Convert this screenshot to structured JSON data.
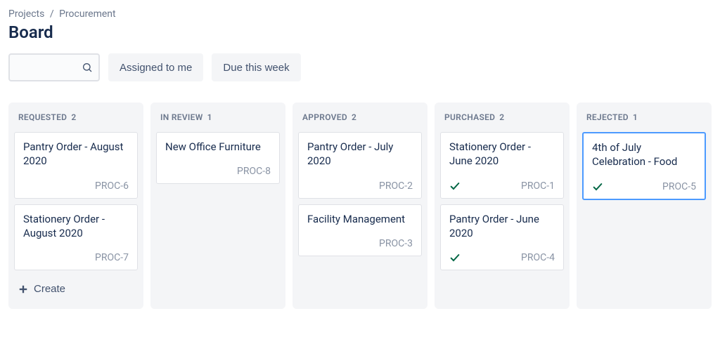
{
  "breadcrumb": {
    "root": "Projects",
    "current": "Procurement"
  },
  "page_title": "Board",
  "search": {
    "placeholder": ""
  },
  "filters": [
    {
      "key": "assigned",
      "label": "Assigned to me"
    },
    {
      "key": "due",
      "label": "Due this week"
    }
  ],
  "create_label": "Create",
  "columns": [
    {
      "key": "requested",
      "title": "REQUESTED",
      "count": 2,
      "show_create": true,
      "cards": [
        {
          "title": "Pantry Order - August 2020",
          "id": "PROC-6",
          "done": false,
          "selected": false
        },
        {
          "title": "Stationery Order - August 2020",
          "id": "PROC-7",
          "done": false,
          "selected": false
        }
      ]
    },
    {
      "key": "in_review",
      "title": "IN REVIEW",
      "count": 1,
      "show_create": false,
      "cards": [
        {
          "title": "New Office Furniture",
          "id": "PROC-8",
          "done": false,
          "selected": false
        }
      ]
    },
    {
      "key": "approved",
      "title": "APPROVED",
      "count": 2,
      "show_create": false,
      "cards": [
        {
          "title": "Pantry Order - July 2020",
          "id": "PROC-2",
          "done": false,
          "selected": false
        },
        {
          "title": "Facility Management",
          "id": "PROC-3",
          "done": false,
          "selected": false
        }
      ]
    },
    {
      "key": "purchased",
      "title": "PURCHASED",
      "count": 2,
      "show_create": false,
      "cards": [
        {
          "title": "Stationery Order - June 2020",
          "id": "PROC-1",
          "done": true,
          "selected": false
        },
        {
          "title": "Pantry Order - June 2020",
          "id": "PROC-4",
          "done": true,
          "selected": false
        }
      ]
    },
    {
      "key": "rejected",
      "title": "REJECTED",
      "count": 1,
      "show_create": false,
      "cards": [
        {
          "title": "4th of July Celebration - Food",
          "id": "PROC-5",
          "done": true,
          "selected": true
        }
      ]
    }
  ]
}
